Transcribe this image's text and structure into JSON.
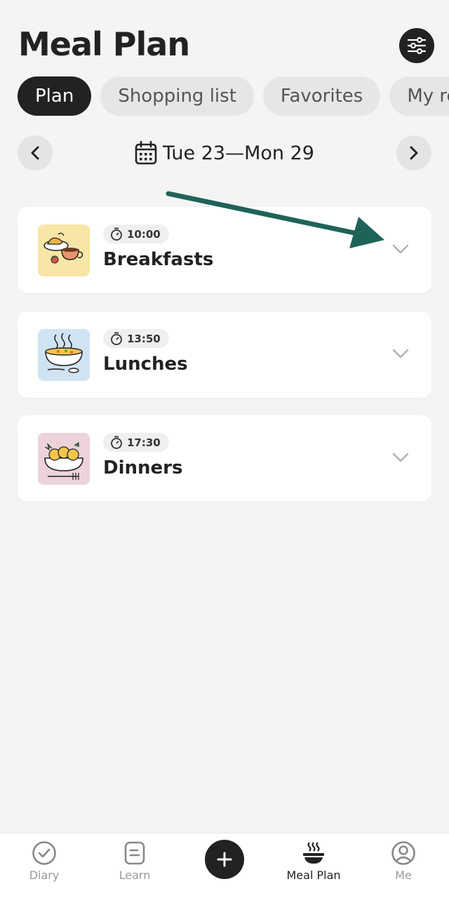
{
  "header": {
    "title": "Meal Plan",
    "settings_icon": "sliders-icon"
  },
  "tabs": [
    {
      "label": "Plan",
      "active": true
    },
    {
      "label": "Shopping list",
      "active": false
    },
    {
      "label": "Favorites",
      "active": false
    },
    {
      "label": "My recipes",
      "active": false
    }
  ],
  "week": {
    "range": "Tue 23—Mon 29",
    "calendar_icon": "calendar-icon"
  },
  "annotation": {
    "arrow_color": "#1f6358"
  },
  "meals": [
    {
      "time": "10:00",
      "name": "Breakfasts",
      "thumb_bg": "#f8e6a6",
      "icon": "breakfast-icon"
    },
    {
      "time": "13:50",
      "name": "Lunches",
      "thumb_bg": "#cfe3f3",
      "icon": "soup-icon"
    },
    {
      "time": "17:30",
      "name": "Dinners",
      "thumb_bg": "#ecd3da",
      "icon": "pasta-icon"
    }
  ],
  "bottom_nav": {
    "diary": "Diary",
    "learn": "Learn",
    "add": "+",
    "meal_plan": "Meal Plan",
    "me": "Me"
  }
}
